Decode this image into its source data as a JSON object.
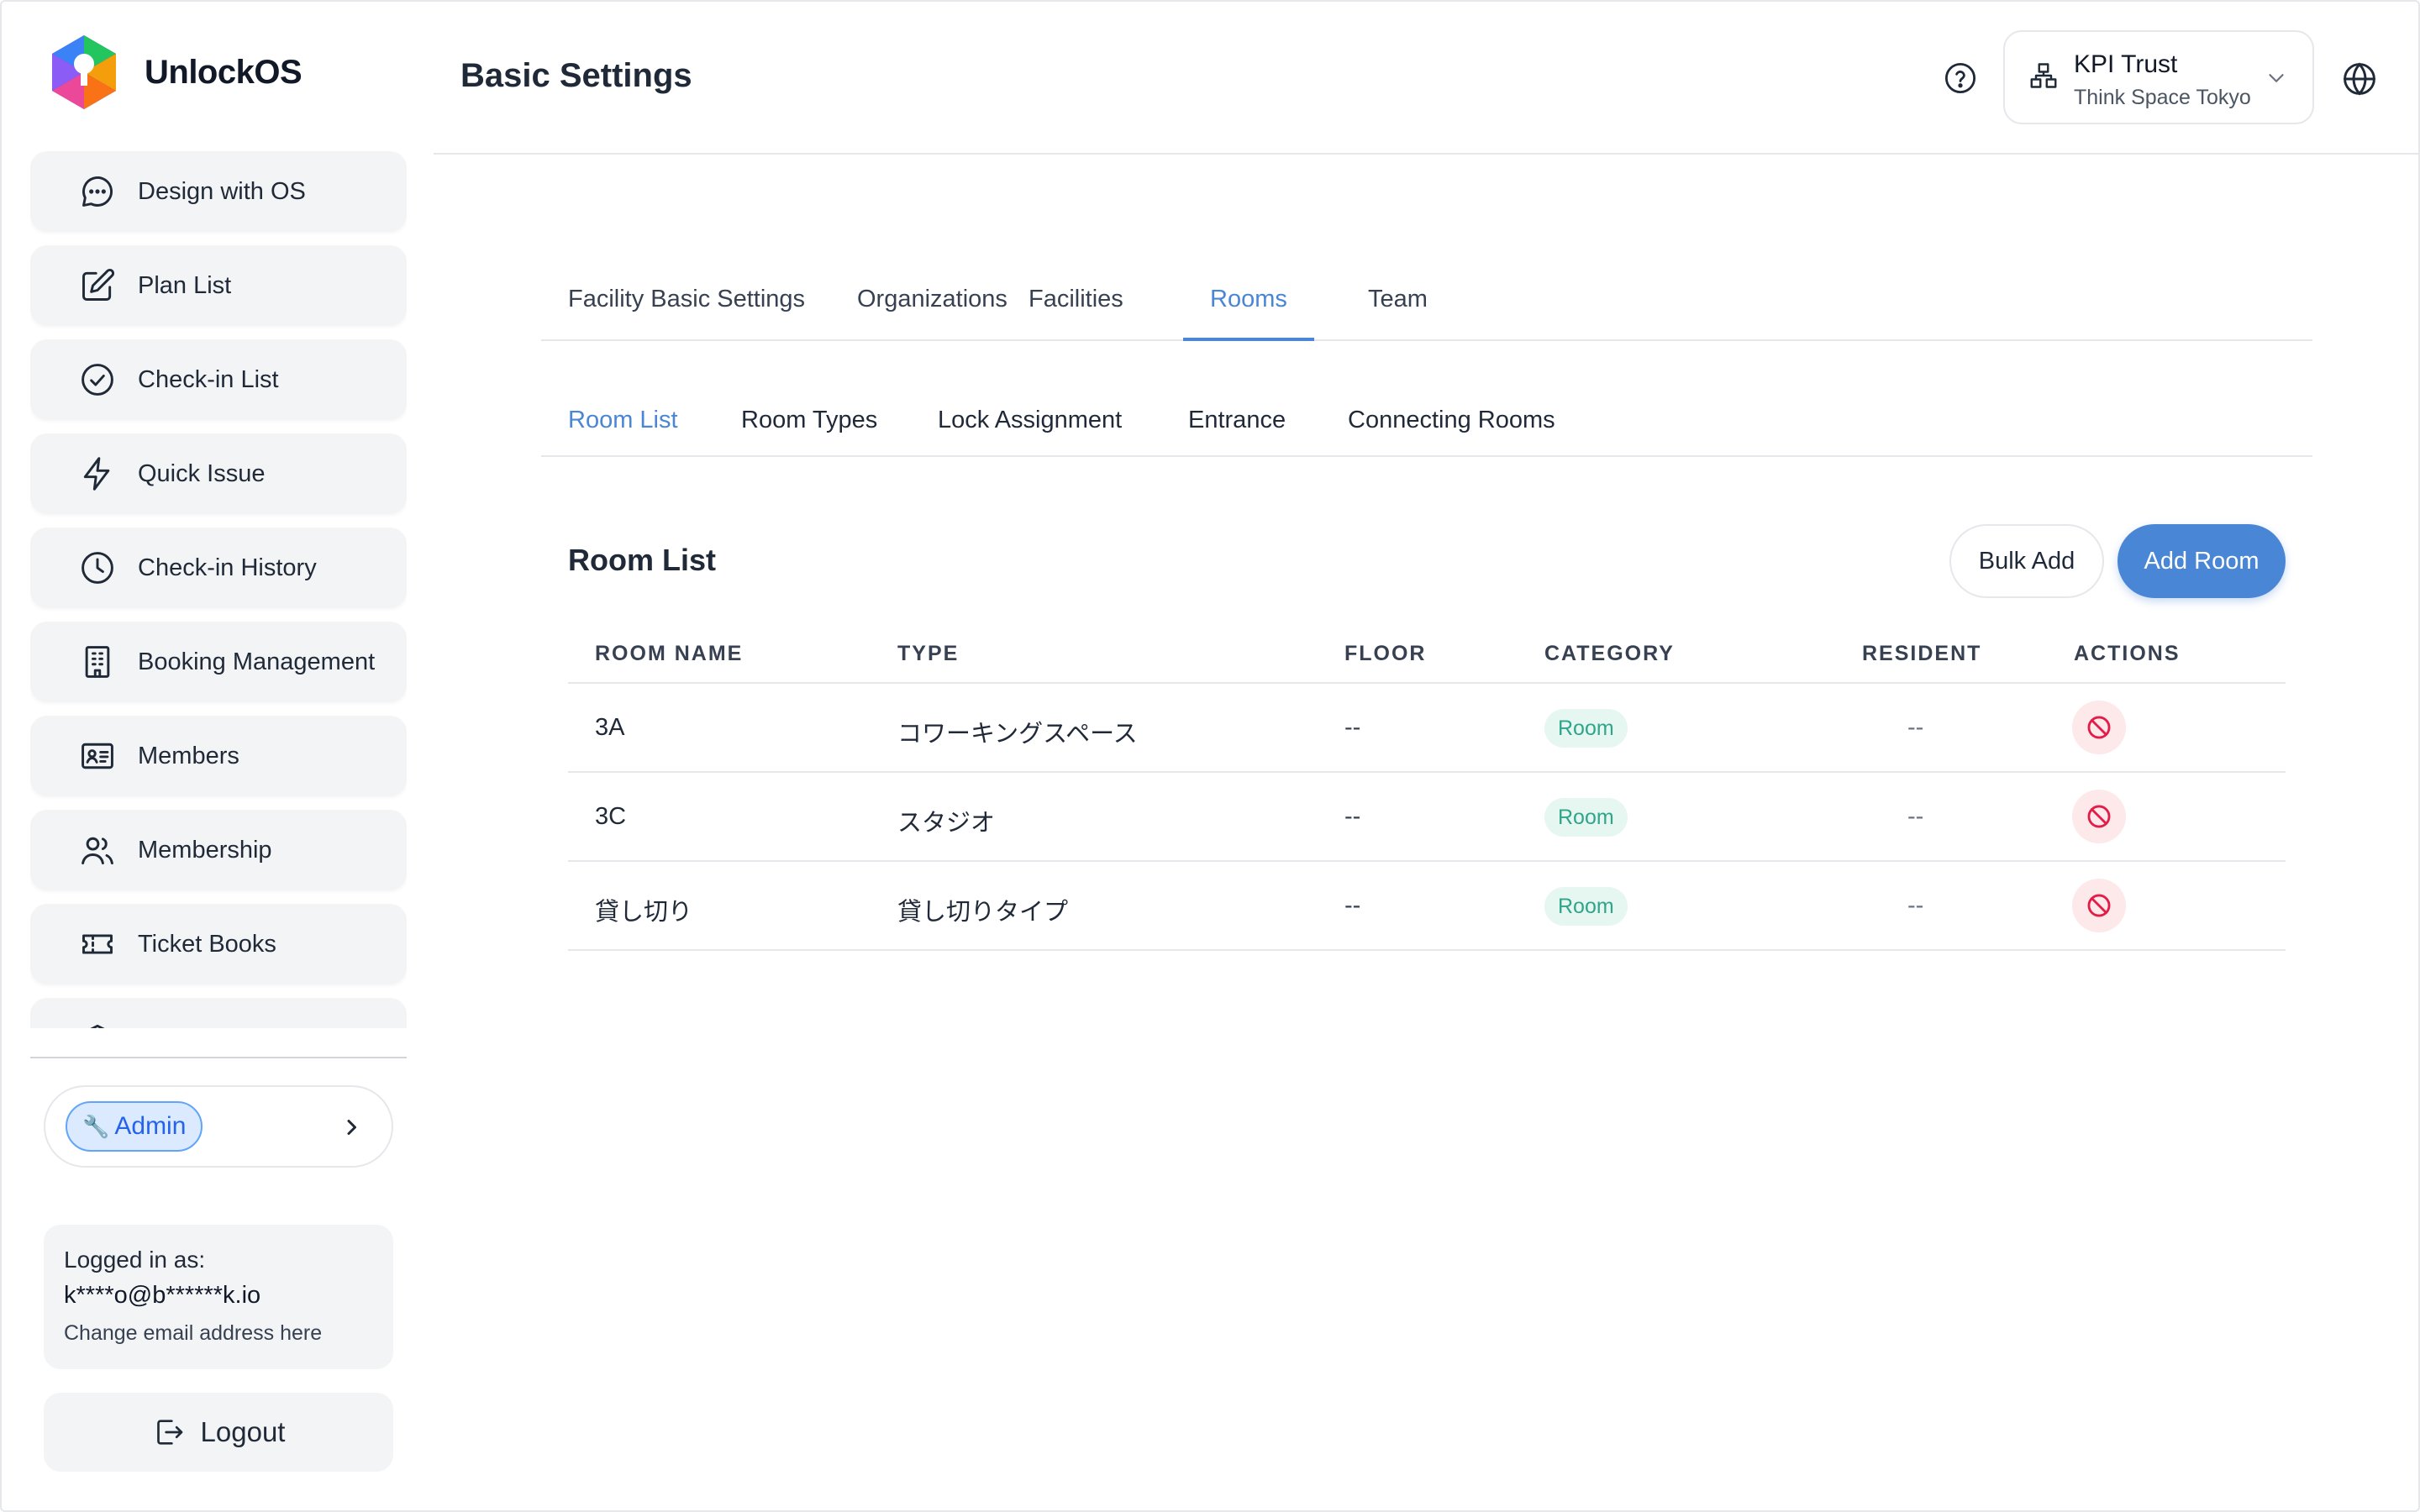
{
  "app": {
    "name": "UnlockOS"
  },
  "sidebar": {
    "items": [
      {
        "label": "Design with OS",
        "icon": "chat-bubble-icon"
      },
      {
        "label": "Plan List",
        "icon": "edit-square-icon"
      },
      {
        "label": "Check-in List",
        "icon": "check-circle-icon"
      },
      {
        "label": "Quick Issue",
        "icon": "lightning-icon"
      },
      {
        "label": "Check-in History",
        "icon": "clock-icon"
      },
      {
        "label": "Booking Management",
        "icon": "building-icon"
      },
      {
        "label": "Members",
        "icon": "id-card-icon"
      },
      {
        "label": "Membership",
        "icon": "users-icon"
      },
      {
        "label": "Ticket Books",
        "icon": "ticket-icon"
      }
    ],
    "role": {
      "label": "Admin",
      "icon": "wrench-icon"
    },
    "login": {
      "label": "Logged in as:",
      "email": "k****o@b******k.io",
      "change_link": "Change email address here"
    },
    "logout_label": "Logout"
  },
  "header": {
    "title": "Basic Settings",
    "org": {
      "name": "KPI Trust",
      "facility": "Think Space Tokyo"
    }
  },
  "tabs": [
    "Facility Basic Settings",
    "Organizations",
    "Facilities",
    "Rooms",
    "Team"
  ],
  "active_tab": "Rooms",
  "subtabs": [
    "Room List",
    "Room Types",
    "Lock Assignment",
    "Entrance",
    "Connecting Rooms"
  ],
  "active_subtab": "Room List",
  "section": {
    "title": "Room List",
    "bulk_add_label": "Bulk Add",
    "add_room_label": "Add Room"
  },
  "table": {
    "columns": [
      "ROOM NAME",
      "TYPE",
      "FLOOR",
      "CATEGORY",
      "RESIDENT",
      "ACTIONS"
    ],
    "rows": [
      {
        "room_name": "3A",
        "type": "コワーキングスペース",
        "floor": "--",
        "category": "Room",
        "resident": "--"
      },
      {
        "room_name": "3C",
        "type": "スタジオ",
        "floor": "--",
        "category": "Room",
        "resident": "--"
      },
      {
        "room_name": "貸し切り",
        "type": "貸し切りタイプ",
        "floor": "--",
        "category": "Room",
        "resident": "--"
      }
    ]
  },
  "colors": {
    "accent": "#4a86d6",
    "badge_text": "#2fa58a",
    "danger": "#e11d48"
  }
}
